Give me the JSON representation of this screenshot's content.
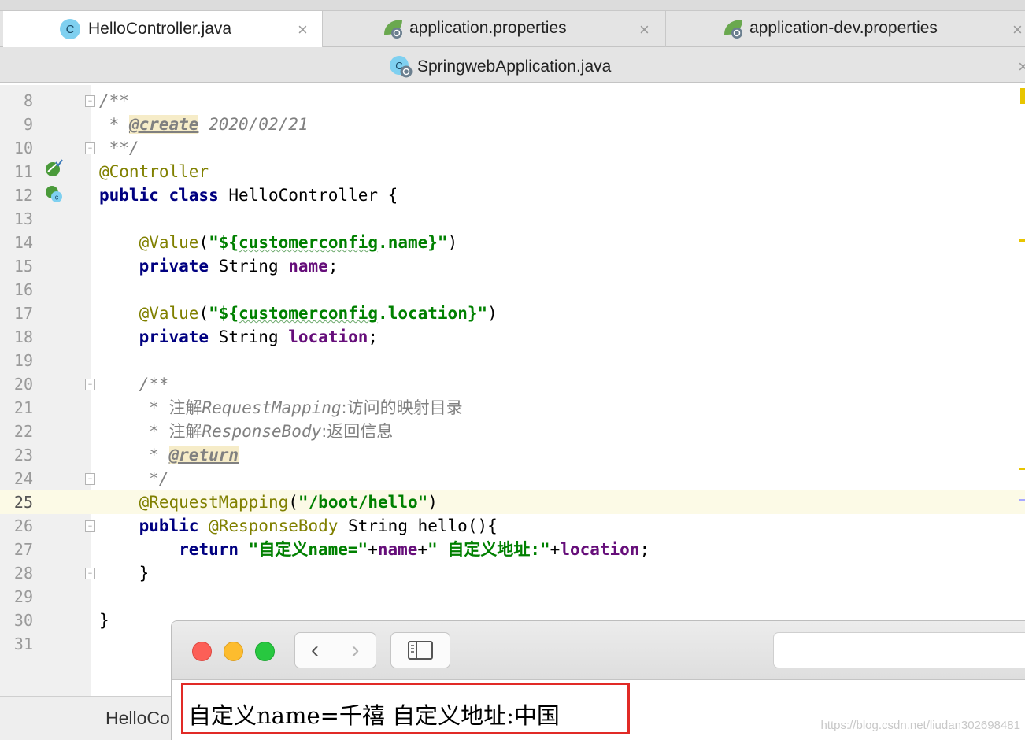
{
  "tabs_row1": [
    {
      "label": "HelloController.java",
      "icon": "java-class-icon",
      "active": true
    },
    {
      "label": "application.properties",
      "icon": "spring-properties-icon",
      "active": false
    },
    {
      "label": "application-dev.properties",
      "icon": "spring-properties-icon",
      "active": false
    }
  ],
  "tabs_row2": [
    {
      "label": "SpringwebApplication.java",
      "icon": "spring-boot-class-icon"
    }
  ],
  "close_glyph": "×",
  "editor": {
    "current_line": 25,
    "lines": [
      {
        "n": "8",
        "seg": [
          {
            "t": "/**",
            "c": "cmt"
          }
        ]
      },
      {
        "n": "9",
        "seg": [
          {
            "t": " * ",
            "c": "cmt"
          },
          {
            "t": "@create",
            "c": "doctag"
          },
          {
            "t": " 2020/02/21",
            "c": "cmt"
          }
        ]
      },
      {
        "n": "10",
        "seg": [
          {
            "t": " **/",
            "c": "cmt"
          }
        ]
      },
      {
        "n": "11",
        "seg": [
          {
            "t": "@Controller",
            "c": "ann"
          }
        ]
      },
      {
        "n": "12",
        "seg": [
          {
            "t": "public class ",
            "c": "kw"
          },
          {
            "t": "HelloController {",
            "c": ""
          }
        ]
      },
      {
        "n": "13",
        "seg": []
      },
      {
        "n": "14",
        "seg": [
          {
            "t": "    ",
            "c": ""
          },
          {
            "t": "@Value",
            "c": "ann"
          },
          {
            "t": "(",
            "c": ""
          },
          {
            "t": "\"${",
            "c": "str"
          },
          {
            "t": "customerconfig",
            "c": "str squig"
          },
          {
            "t": ".name}\"",
            "c": "str"
          },
          {
            "t": ")",
            "c": ""
          }
        ]
      },
      {
        "n": "15",
        "seg": [
          {
            "t": "    ",
            "c": ""
          },
          {
            "t": "private ",
            "c": "kw"
          },
          {
            "t": "String ",
            "c": ""
          },
          {
            "t": "name",
            "c": "fld"
          },
          {
            "t": ";",
            "c": ""
          }
        ]
      },
      {
        "n": "16",
        "seg": []
      },
      {
        "n": "17",
        "seg": [
          {
            "t": "    ",
            "c": ""
          },
          {
            "t": "@Value",
            "c": "ann"
          },
          {
            "t": "(",
            "c": ""
          },
          {
            "t": "\"${",
            "c": "str"
          },
          {
            "t": "customerconfig",
            "c": "str squig"
          },
          {
            "t": ".location}\"",
            "c": "str"
          },
          {
            "t": ")",
            "c": ""
          }
        ]
      },
      {
        "n": "18",
        "seg": [
          {
            "t": "    ",
            "c": ""
          },
          {
            "t": "private ",
            "c": "kw"
          },
          {
            "t": "String ",
            "c": ""
          },
          {
            "t": "location",
            "c": "fld"
          },
          {
            "t": ";",
            "c": ""
          }
        ]
      },
      {
        "n": "19",
        "seg": []
      },
      {
        "n": "20",
        "seg": [
          {
            "t": "    /**",
            "c": "cmt"
          }
        ]
      },
      {
        "n": "21",
        "seg": [
          {
            "t": "     * ",
            "c": "cmt"
          },
          {
            "t": "注解",
            "c": "cmt cjk"
          },
          {
            "t": "RequestMapping",
            "c": "cmt"
          },
          {
            "t": ":访问的映射目录",
            "c": "cmt cjk"
          }
        ]
      },
      {
        "n": "22",
        "seg": [
          {
            "t": "     * ",
            "c": "cmt"
          },
          {
            "t": "注解",
            "c": "cmt cjk"
          },
          {
            "t": "ResponseBody",
            "c": "cmt"
          },
          {
            "t": ":返回信息",
            "c": "cmt cjk"
          }
        ]
      },
      {
        "n": "23",
        "seg": [
          {
            "t": "     * ",
            "c": "cmt"
          },
          {
            "t": "@return",
            "c": "doctag"
          }
        ]
      },
      {
        "n": "24",
        "seg": [
          {
            "t": "     */",
            "c": "cmt"
          }
        ]
      },
      {
        "n": "25",
        "seg": [
          {
            "t": "    ",
            "c": ""
          },
          {
            "t": "@RequestMapping",
            "c": "ann"
          },
          {
            "t": "(",
            "c": ""
          },
          {
            "t": "\"/boot/hello\"",
            "c": "str"
          },
          {
            "t": ")",
            "c": ""
          }
        ]
      },
      {
        "n": "26",
        "seg": [
          {
            "t": "    ",
            "c": ""
          },
          {
            "t": "public ",
            "c": "kw"
          },
          {
            "t": "@ResponseBody",
            "c": "ann"
          },
          {
            "t": " String hello(){",
            "c": ""
          }
        ]
      },
      {
        "n": "27",
        "seg": [
          {
            "t": "        ",
            "c": ""
          },
          {
            "t": "return ",
            "c": "kw"
          },
          {
            "t": "\"自定义name=\"",
            "c": "str"
          },
          {
            "t": "+",
            "c": ""
          },
          {
            "t": "name",
            "c": "fld"
          },
          {
            "t": "+",
            "c": ""
          },
          {
            "t": "\" 自定义地址:\"",
            "c": "str"
          },
          {
            "t": "+",
            "c": ""
          },
          {
            "t": "location",
            "c": "fld"
          },
          {
            "t": ";",
            "c": ""
          }
        ]
      },
      {
        "n": "28",
        "seg": [
          {
            "t": "    }",
            "c": ""
          }
        ]
      },
      {
        "n": "29",
        "seg": []
      },
      {
        "n": "30",
        "seg": [
          {
            "t": "}",
            "c": ""
          }
        ]
      },
      {
        "n": "31",
        "seg": []
      }
    ],
    "fold_lines": [
      8,
      10,
      20,
      24,
      26,
      28
    ]
  },
  "bottom_tab": "HelloCo",
  "browser": {
    "back_glyph": "‹",
    "forward_glyph": "›",
    "result_text": "自定义name=千禧 自定义地址:中国",
    "watermark": "https://blog.csdn.net/liudan302698481"
  },
  "colors": {
    "keyword": "#000080",
    "annotation": "#808000",
    "string": "#008000",
    "field": "#660e7a",
    "comment": "#808080",
    "highlight_box": "#e12a26"
  }
}
